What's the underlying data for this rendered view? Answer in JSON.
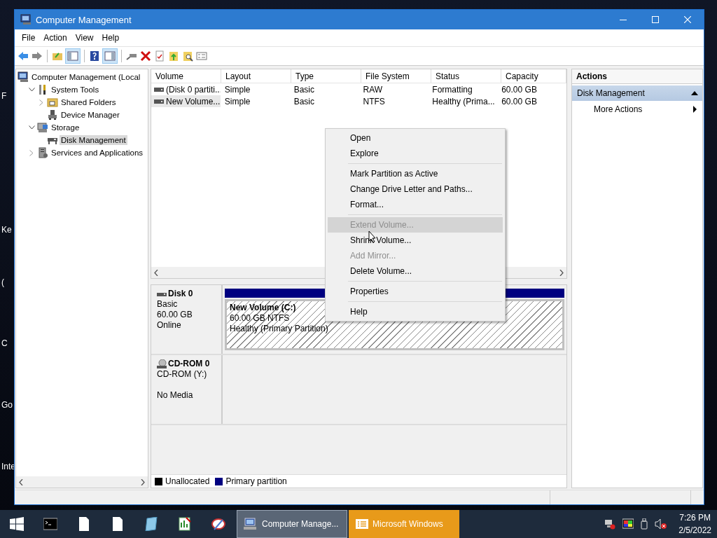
{
  "desktop_labels": [
    "F",
    "Ke",
    "(",
    "C",
    "Go",
    "Inte"
  ],
  "window": {
    "title": "Computer Management"
  },
  "menu": [
    "File",
    "Action",
    "View",
    "Help"
  ],
  "tree": [
    {
      "label": "Computer Management (Local",
      "kind": "computer",
      "selected": false,
      "children": [
        {
          "label": "System Tools",
          "kind": "tools",
          "expanded": true,
          "selected": false,
          "children": [
            {
              "label": "Shared Folders",
              "kind": "shared",
              "expanded": false,
              "selected": false
            },
            {
              "label": "Device Manager",
              "kind": "device",
              "selected": false
            }
          ]
        },
        {
          "label": "Storage",
          "kind": "storage",
          "expanded": true,
          "selected": false,
          "children": [
            {
              "label": "Disk Management",
              "kind": "disk",
              "selected": true
            }
          ]
        },
        {
          "label": "Services and Applications",
          "kind": "services",
          "expanded": false,
          "selected": false
        }
      ]
    }
  ],
  "volumes": {
    "columns": [
      "Volume",
      "Layout",
      "Type",
      "File System",
      "Status",
      "Capacity"
    ],
    "rows": [
      {
        "cells": [
          "(Disk 0 partiti...",
          "Simple",
          "Basic",
          "RAW",
          "Formatting",
          "60.00 GB"
        ],
        "selected": false
      },
      {
        "cells": [
          "New Volume...",
          "Simple",
          "Basic",
          "NTFS",
          "Healthy (Prima...",
          "60.00 GB"
        ],
        "selected": true
      }
    ]
  },
  "disks": [
    {
      "name": "Disk 0",
      "kind": "disk",
      "type": "Basic",
      "size": "60.00 GB",
      "status": "Online",
      "partitions": [
        {
          "name": "New Volume  (C:)",
          "size": "60.00 GB NTFS",
          "status": "Healthy (Primary Partition)",
          "color": "#000080"
        }
      ]
    },
    {
      "name": "CD-ROM 0",
      "kind": "cdrom",
      "type": "CD-ROM (Y:)",
      "status": "No Media"
    }
  ],
  "legend": [
    {
      "label": "Unallocated",
      "color": "#000000"
    },
    {
      "label": "Primary partition",
      "color": "#000080"
    }
  ],
  "actions": {
    "title": "Actions",
    "items": [
      {
        "label": "Disk Management",
        "kind": "header"
      },
      {
        "label": "More Actions",
        "kind": "submenu"
      }
    ]
  },
  "context_menu": [
    {
      "kind": "item",
      "label": "Open",
      "disabled": false,
      "hovered": false
    },
    {
      "kind": "item",
      "label": "Explore",
      "disabled": false,
      "hovered": false
    },
    {
      "kind": "separator"
    },
    {
      "kind": "item",
      "label": "Mark Partition as Active",
      "disabled": false,
      "hovered": false
    },
    {
      "kind": "item",
      "label": "Change Drive Letter and Paths...",
      "disabled": false,
      "hovered": false
    },
    {
      "kind": "item",
      "label": "Format...",
      "disabled": false,
      "hovered": false
    },
    {
      "kind": "separator"
    },
    {
      "kind": "item",
      "label": "Extend Volume...",
      "disabled": true,
      "hovered": true
    },
    {
      "kind": "item",
      "label": "Shrink Volume...",
      "disabled": false,
      "hovered": false
    },
    {
      "kind": "item",
      "label": "Add Mirror...",
      "disabled": true,
      "hovered": false
    },
    {
      "kind": "item",
      "label": "Delete Volume...",
      "disabled": false,
      "hovered": false
    },
    {
      "kind": "separator"
    },
    {
      "kind": "item",
      "label": "Properties",
      "disabled": false,
      "hovered": false
    },
    {
      "kind": "separator"
    },
    {
      "kind": "item",
      "label": "Help",
      "disabled": false,
      "hovered": false
    }
  ],
  "taskbar": {
    "pinned": [
      {
        "kind": "console"
      },
      {
        "kind": "document"
      },
      {
        "kind": "document"
      },
      {
        "kind": "notebook"
      },
      {
        "kind": "chart"
      },
      {
        "kind": "paint"
      }
    ],
    "tasks": [
      {
        "label": "Computer Manage...",
        "selected": true,
        "kind": "normal"
      },
      {
        "label": "Microsoft Windows",
        "selected": false,
        "kind": "flashing"
      }
    ],
    "clock": {
      "time": "7:26 PM",
      "date": "2/5/2022"
    }
  }
}
